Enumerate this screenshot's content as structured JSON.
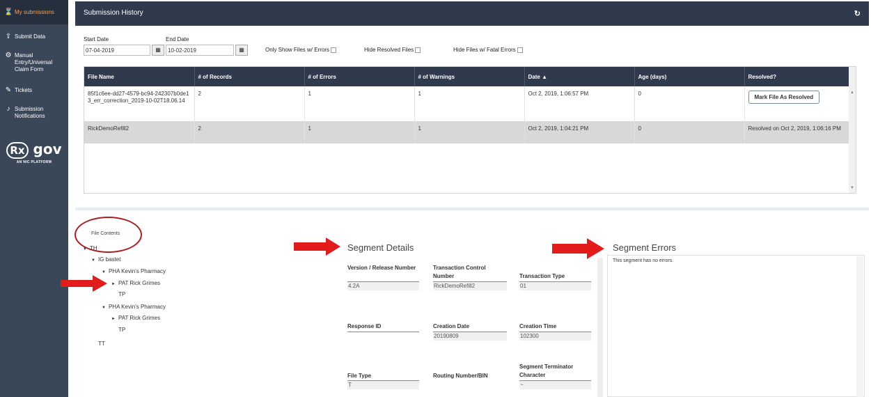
{
  "sidebar": {
    "items": [
      {
        "icon": "hourglass-icon",
        "label": "My submissions",
        "active": true
      },
      {
        "icon": "upload-icon",
        "label": "Submit Data"
      },
      {
        "icon": "gear-icon",
        "label": "Manual Entry/Universal Claim Form"
      },
      {
        "icon": "tag-icon",
        "label": "Tickets"
      },
      {
        "icon": "bell-icon",
        "label": "Submission Notifications"
      }
    ],
    "logo": {
      "text": "Rx gov",
      "subtitle": "AN NIC PLATFORM"
    }
  },
  "header": {
    "title": "Submission History",
    "refresh_icon": "refresh-icon"
  },
  "filters": {
    "start_date_label": "Start Date",
    "start_date": "07-04-2019",
    "end_date_label": "End Date",
    "end_date": "10-02-2019",
    "only_errors_label": "Only Show Files w/ Errors",
    "hide_resolved_label": "Hide Resolved Files",
    "hide_fatal_label": "Hide Files w/ Fatal Errors"
  },
  "table": {
    "columns": [
      "File Name",
      "# of Records",
      "# of Errors",
      "# of Warnings",
      "Date ▲",
      "Age (days)",
      "Resolved?"
    ],
    "rows": [
      {
        "file_name": "85f1c6ee-dd27-4579-bc94-242307b0de13_err_correction_2019-10-02T18.06.14",
        "records": "2",
        "errors": "1",
        "warnings": "1",
        "date": "Oct 2, 2019, 1:06:57 PM",
        "age": "0",
        "resolved": "",
        "button": "Mark File As Resolved"
      },
      {
        "file_name": "RickDemoRefill2",
        "records": "2",
        "errors": "1",
        "warnings": "1",
        "date": "Oct 2, 2019, 1:04:21 PM",
        "age": "0",
        "resolved": "Resolved on Oct 2, 2019, 1:06:16 PM",
        "button": ""
      }
    ]
  },
  "file_contents": {
    "title": "File Contents",
    "tree": [
      {
        "text": "TH",
        "marker": "▼"
      },
      {
        "text": "IG bastet",
        "marker": "▼"
      },
      {
        "text": "PHA Kevin's Pharmacy",
        "marker": "▼"
      },
      {
        "text": "PAT Rick Grimes",
        "marker": "►"
      },
      {
        "text": "TP",
        "marker": ""
      },
      {
        "text": "PHA Kevin's Pharmacy",
        "marker": "▼"
      },
      {
        "text": "PAT Rick Grimes",
        "marker": "►"
      },
      {
        "text": "TP",
        "marker": ""
      },
      {
        "text": "TT",
        "marker": ""
      }
    ]
  },
  "segment_details": {
    "title": "Segment Details",
    "fields": [
      {
        "label": "Version / Release Number",
        "value": "4.2A"
      },
      {
        "label": "Transaction Control Number",
        "value": "RickDemoRefill2"
      },
      {
        "label": "Transaction Type",
        "value": "01"
      },
      {
        "label": "Response ID",
        "value": ""
      },
      {
        "label": "Creation Date",
        "value": "20190809"
      },
      {
        "label": "Creation Time",
        "value": "102300"
      },
      {
        "label": "File Type",
        "value": "T"
      },
      {
        "label": "Routing Number/BIN",
        "value": ""
      },
      {
        "label": "Segment Terminator Character",
        "value": "~"
      }
    ]
  },
  "segment_errors": {
    "title": "Segment Errors",
    "message": "This segment has no errors."
  },
  "colors": {
    "sidebar": "#3a4759",
    "header": "#2f3b4d",
    "accent": "#f0a35e",
    "highlight": "#a82020",
    "arrow": "#e21b1b"
  }
}
